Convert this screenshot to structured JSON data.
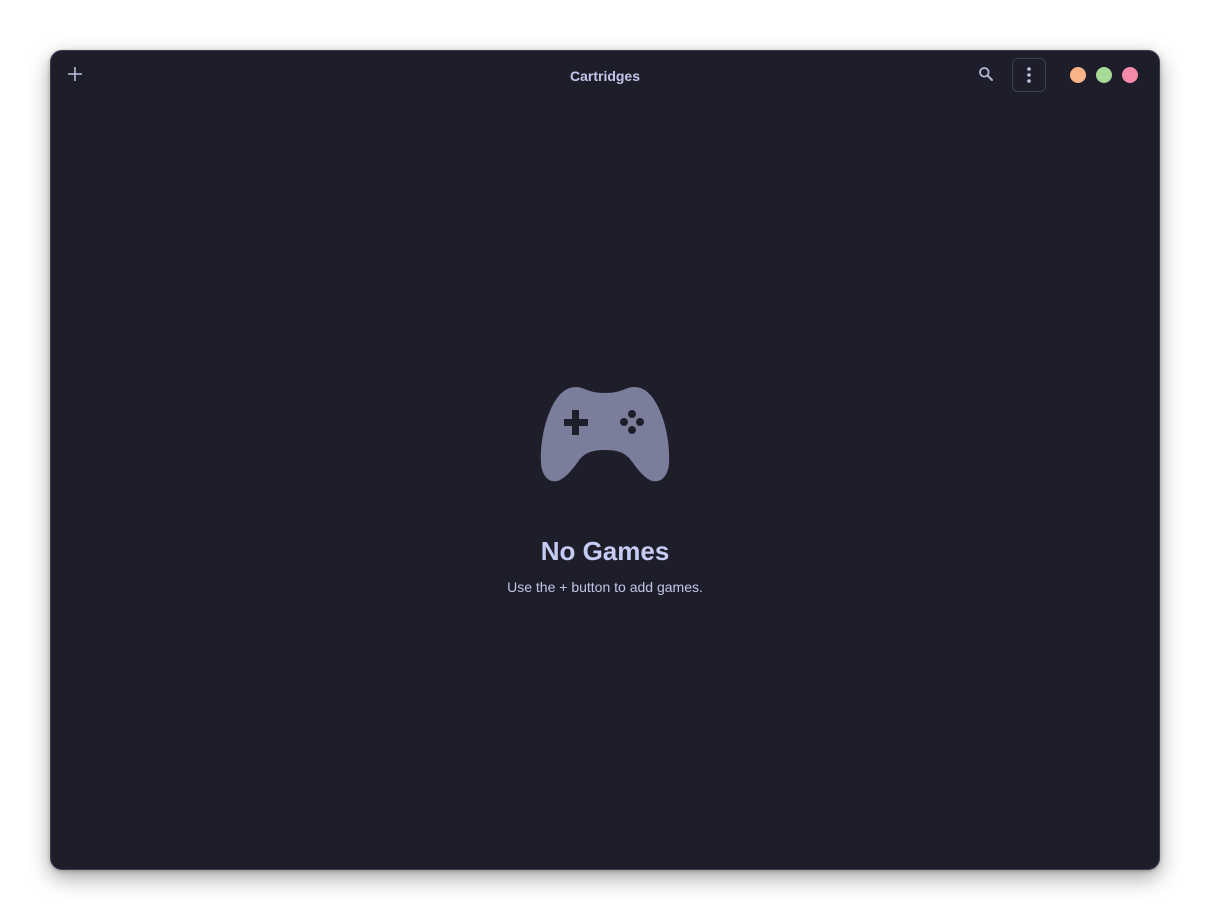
{
  "window": {
    "title": "Cartridges"
  },
  "header": {
    "add_icon": "plus-icon",
    "search_icon": "search-icon",
    "menu_icon": "vertical-dots-icon"
  },
  "window_controls": {
    "minimize_color": "#fab387",
    "maximize_color": "#a6da95",
    "close_color": "#f38ba8"
  },
  "empty_state": {
    "icon": "gamepad-icon",
    "title": "No Games",
    "description": "Use the + button to add games."
  },
  "colors": {
    "background": "#1e1e2b",
    "icon_fill": "#7b7e9b",
    "text": "#c6cbf4"
  }
}
